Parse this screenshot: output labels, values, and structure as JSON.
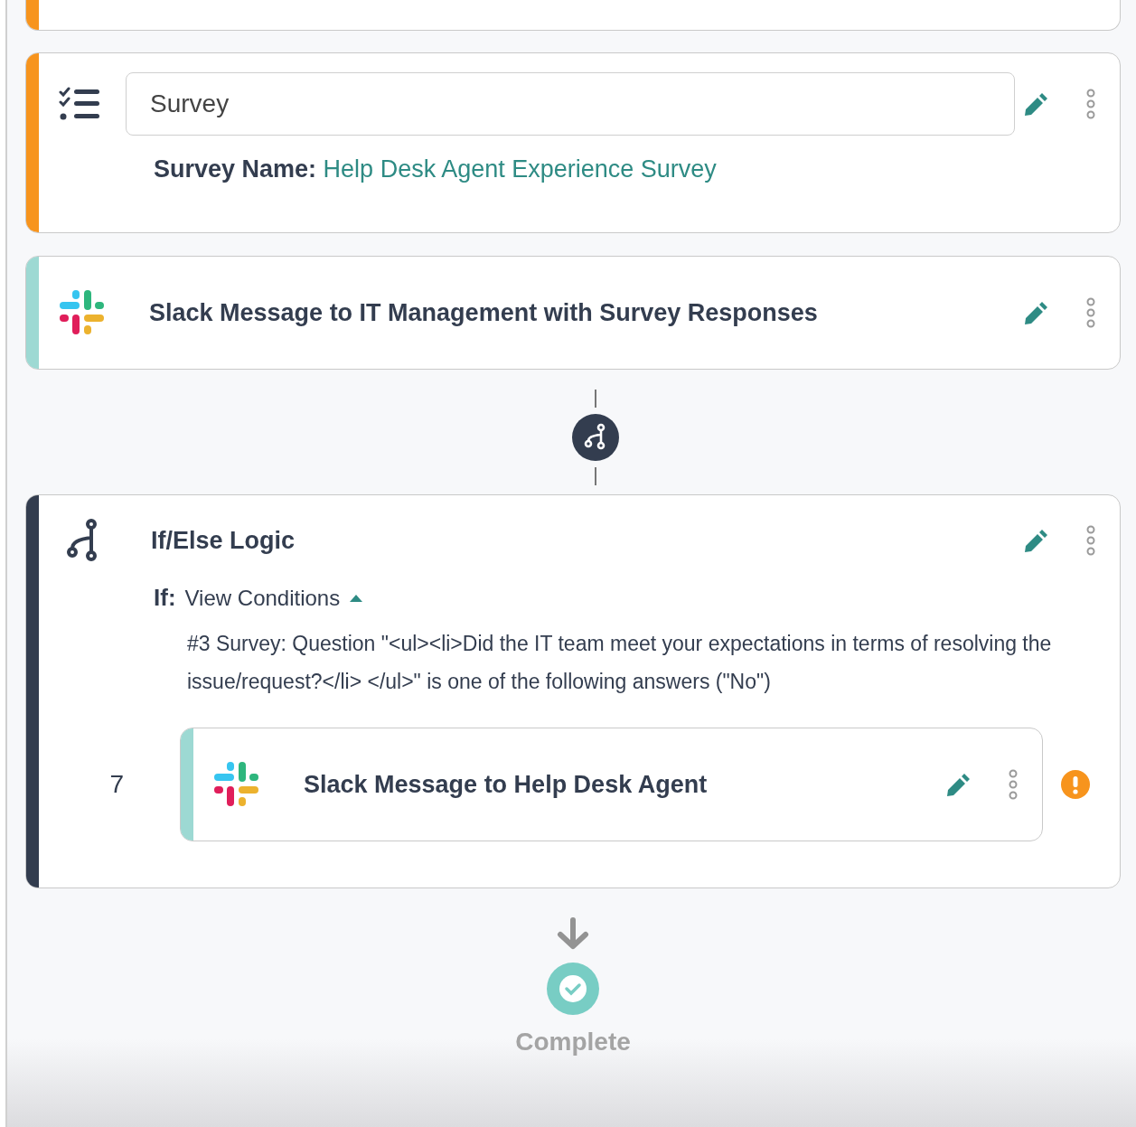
{
  "steps": [
    {
      "kind": "partial",
      "color": "#f7941d"
    },
    {
      "kind": "survey",
      "color": "#f7941d",
      "name": "Survey",
      "detail_label": "Survey Name:",
      "detail_value": "Help Desk Agent Experience Survey"
    },
    {
      "kind": "slack",
      "color": "#9dd9d3",
      "title": "Slack Message to IT Management with Survey Responses"
    },
    {
      "kind": "branch-connector"
    },
    {
      "kind": "logic",
      "color": "#333d4f",
      "title": "If/Else Logic",
      "if_label": "If:",
      "conditions_link": "View Conditions",
      "expanded": true,
      "condition": "#3 Survey: Question \"<ul><li>Did the IT team meet your expectations in terms of resolving the issue/request?</li> </ul>\" is one of the following answers (\"No\")",
      "children": [
        {
          "number": "7",
          "kind": "slack",
          "color": "#9dd9d3",
          "title": "Slack Message to Help Desk Agent",
          "warning": true
        }
      ]
    }
  ],
  "end": {
    "label": "Complete"
  }
}
